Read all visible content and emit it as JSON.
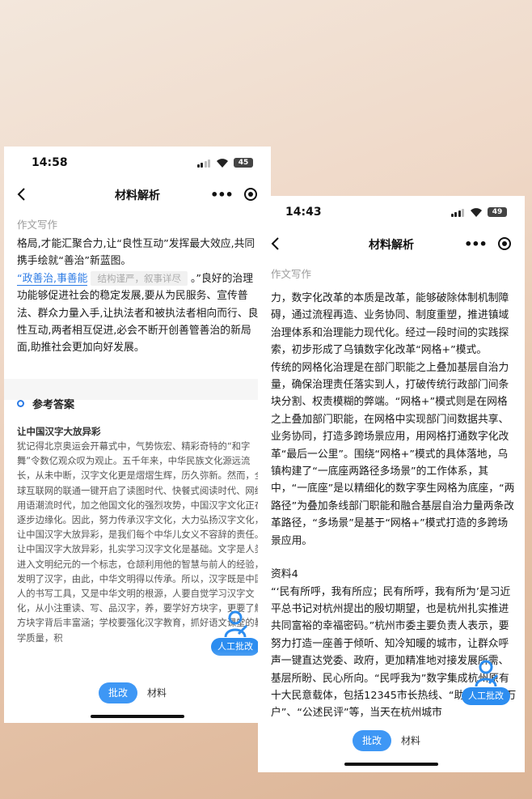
{
  "phone1": {
    "status": {
      "time": "14:58",
      "battery": "45"
    },
    "nav": {
      "title": "材料解析"
    },
    "section_label": "作文写作",
    "para1": "格局,才能汇聚合力,让“良性互动”发挥最大效应,共同携手绘就“善治”新蓝图。",
    "highlight": "“政善治,事善能",
    "hint": "结构谨严，叙事详尽",
    "para2_tail": "。”良好的治理功能够促进社会的稳定发展,要从为民服务、宣传普法、群众力量入手,让执法者和被执法者相向而行、良性互动,两者相互促进,必会不断开创善管善治的新局面,助推社会更加向好发展。",
    "ref_title": "参考答案",
    "essay_title": "让中国汉字大放异彩",
    "essay_p1": "犹记得北京奥运会开幕式中，气势恢宏、精彩奇特的“和字舞”令数亿观众叹为观止。五千年来，中华民族文化源远流长，从未中断，汉字文化更是熠熠生辉，历久弥新。然而，全球互联网的联通一键开启了读图时代、快餐式阅读时代、网络用语潮流时代，加之他国文化的强烈攻势，中国汉字文化正在逐步边缘化。因此，努力传承汉字文化，大力弘扬汉字文化，让中国汉字大放异彩，是我们每个中华儿女义不容辞的责任。",
    "essay_p2": "让中国汉字大放异彩，扎实学习汉字文化是基础。文字是人类进入文明纪元的一个标志，仓颉利用他的智慧与前人的经验，发明了汉字，由此，中华文明得以传承。所以，汉字既是中国人的书写工具，又是中华文明的根源，人要自觉学习汉字文化，从小注重读、写、品汉字，养，要学好方块字，更要了解方块字背后丰富涵；学校要强化汉字教育，抓好语文课堂的教学质量，积",
    "fab_label": "人工批改",
    "tabs": [
      "批改",
      "材料"
    ]
  },
  "phone2": {
    "status": {
      "time": "14:43",
      "battery": "49"
    },
    "nav": {
      "title": "材料解析"
    },
    "section_label": "作文写作",
    "p1": "力，数字化改革的本质是改革，能够破除体制机制障碍，通过流程再造、业务协同、制度重塑，推进镇域治理体系和治理能力现代化。经过一段时间的实践探索，初步形成了乌镇数字化改革“网格+”模式。",
    "p2": "传统的网格化治理是在部门职能之上叠加基层自治力量，确保治理责任落实到人，打破传统行政部门间条块分割、权责模糊的弊端。“网格+”模式则是在网格之上叠加部门职能，在网格中实现部门间数据共享、业务协同，打造多跨场景应用，用网格打通数字化改革“最后一公里”。围绕“网格+”模式的具体落地，乌镇构建了“一底座两路径多场景”的工作体系，其中，“一底座”是以精细化的数字孪生网格为底座，“两路径”为叠加条线部门职能和融合基层自治力量两条改革路径，“多场景”是基于“网格+”模式打造的多跨场景应用。",
    "material_label": "资料4",
    "p3": "“‘民有所呼，我有所应；民有所呼，我有所为’是习近平总书记对杭州提出的殷切期望，也是杭州扎实推进共同富裕的幸福密码。”杭州市委主要负责人表示，要努力打造一座善于倾听、知冷知暖的城市，让群众呼声一键直达党委、政府，更加精准地对接发展所需、基层所盼、民心所向。“民呼我为”数字集成杭州原有十大民意载体，包括12345市长热线、“助万企、帮万户”、“公述民评”等，当天在杭州城市",
    "fab_label": "人工批改",
    "tabs": [
      "批改",
      "材料"
    ]
  },
  "icons": [
    "back-icon",
    "more-dots-icon",
    "capsule-close-icon",
    "wifi-icon",
    "signal-icon",
    "battery-icon",
    "manual-review-icon"
  ],
  "colors": {
    "accent": "#3e97f5",
    "highlight": "#2c7be5",
    "background": "#efd8c7"
  }
}
